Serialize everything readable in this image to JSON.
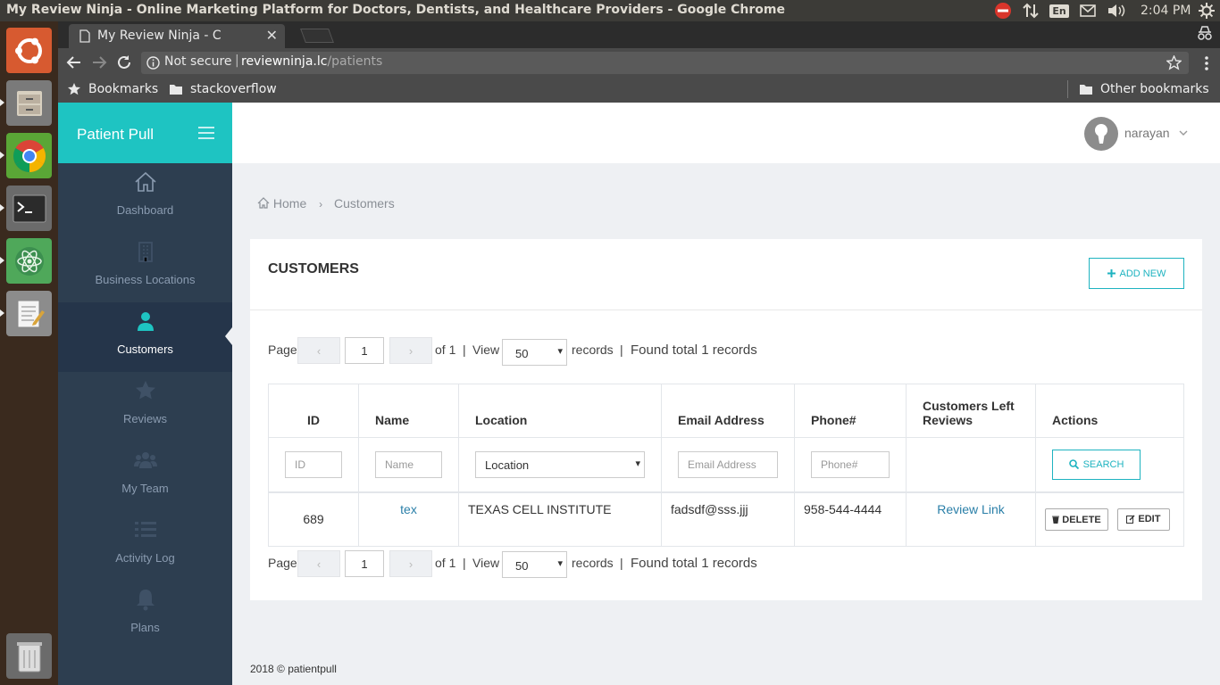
{
  "os": {
    "window_title": "My Review Ninja - Online Marketing Platform for Doctors, Dentists, and Healthcare Providers - Google Chrome",
    "keyboard": "En",
    "clock": "2:04 PM"
  },
  "browser": {
    "tab_title": "My Review Ninja - C",
    "security": "Not secure",
    "url_host": "reviewninja.lc",
    "url_path": "/patients",
    "bookmarks": [
      "Bookmarks",
      "stackoverflow"
    ],
    "other_bookmarks": "Other bookmarks"
  },
  "app": {
    "brand": "Patient Pull",
    "user": "narayan",
    "nav": [
      {
        "label": "Dashboard",
        "icon": "home-icon"
      },
      {
        "label": "Business Locations",
        "icon": "building-icon"
      },
      {
        "label": "Customers",
        "icon": "user-icon",
        "active": true
      },
      {
        "label": "Reviews",
        "icon": "star-icon"
      },
      {
        "label": "My Team",
        "icon": "users-icon"
      },
      {
        "label": "Activity Log",
        "icon": "list-icon"
      },
      {
        "label": "Plans",
        "icon": "bell-icon"
      }
    ],
    "breadcrumb": {
      "home": "Home",
      "current": "Customers"
    },
    "panel_title": "CUSTOMERS",
    "add_new": "ADD NEW",
    "pager": {
      "page_label": "Page",
      "prev": "‹",
      "page": "1",
      "next": "›",
      "of": "of 1",
      "sep": "|",
      "view_label": "View",
      "per_page": "50",
      "records_label": "records",
      "found": "Found total 1 records"
    },
    "table": {
      "headers": [
        "ID",
        "Name",
        "Location",
        "Email Address",
        "Phone#",
        "Customers Left Reviews",
        "Actions"
      ],
      "filters": {
        "id": "ID",
        "name": "Name",
        "location": "Location",
        "email": "Email Address",
        "phone": "Phone#",
        "search": "SEARCH"
      },
      "rows": [
        {
          "id": "689",
          "name": "tex",
          "location": "TEXAS CELL INSTITUTE",
          "email": "fadsdf@sss.jjj",
          "phone": "958-544-4444",
          "review": "Review Link",
          "delete": "DELETE",
          "edit": "EDIT"
        }
      ]
    },
    "footer": "2018 © patientpull"
  },
  "colors": {
    "brand": "#1ec4c2",
    "sidebar": "#2d3e50",
    "accent": "#1eb3c0",
    "link": "#2a7fa8"
  }
}
